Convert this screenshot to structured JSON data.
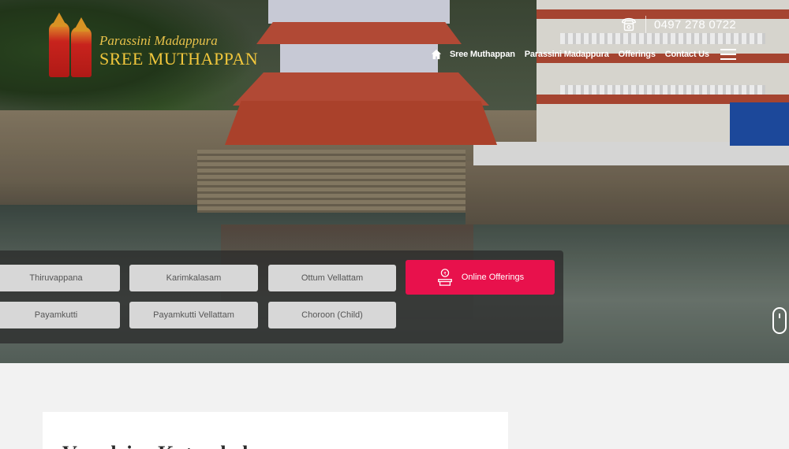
{
  "logo": {
    "line1": "Parassini Madappura",
    "line2": "SREE MUTHAPPAN",
    "icon": "theyyam-figures-icon"
  },
  "header": {
    "phone": "0497 278 0722",
    "phone_icon": "telephone-icon"
  },
  "nav": {
    "home_icon": "home-icon",
    "items": [
      {
        "label": "Sree Muthappan"
      },
      {
        "label": "Parassini Madappura"
      },
      {
        "label": "Offerings"
      },
      {
        "label": "Contact Us"
      }
    ],
    "menu_icon": "hamburger-menu-icon"
  },
  "offerings": {
    "tiles": [
      {
        "label": "Thiruvappana"
      },
      {
        "label": "Karimkalasam"
      },
      {
        "label": "Ottum Vellattam"
      },
      {
        "label": "Payamkutti"
      },
      {
        "label": "Payamkutti Vellattam"
      },
      {
        "label": "Choroon (Child)"
      }
    ],
    "online_button": {
      "label": "Online Offerings",
      "icon": "gift-icon"
    },
    "accent": "#e8114c"
  },
  "content": {
    "card_title": "Vasudaiva Kutumbakam"
  }
}
